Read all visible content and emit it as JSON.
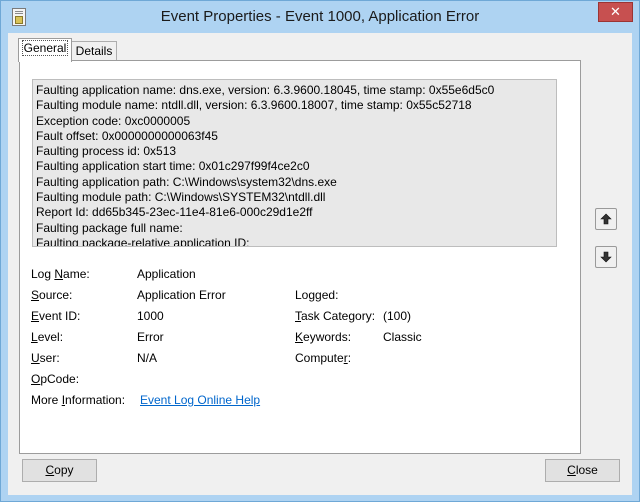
{
  "window": {
    "title": "Event Properties - Event 1000, Application Error",
    "close_glyph": "✕"
  },
  "tabs": [
    {
      "label": "General",
      "active": true
    },
    {
      "label": "Details",
      "active": false
    }
  ],
  "description": [
    "Faulting application name: dns.exe, version: 6.3.9600.18045, time stamp: 0x55e6d5c0",
    "Faulting module name: ntdll.dll, version: 6.3.9600.18007, time stamp: 0x55c52718",
    "Exception code: 0xc0000005",
    "Fault offset: 0x0000000000063f45",
    "Faulting process id: 0x513",
    "Faulting application start time: 0x01c297f99f4ce2c0",
    "Faulting application path: C:\\Windows\\system32\\dns.exe",
    "Faulting module path: C:\\Windows\\SYSTEM32\\ntdll.dll",
    "Report Id: dd65b345-23ec-11e4-81e6-000c29d1e2ff",
    "Faulting package full name:",
    "Faulting package-relative application ID:"
  ],
  "fields": {
    "log_name": {
      "label_pre": "Log ",
      "label_key": "N",
      "label_post": "ame:",
      "value": "Application"
    },
    "source": {
      "label_pre": "",
      "label_key": "S",
      "label_post": "ource:",
      "value": "Application Error"
    },
    "logged": {
      "label_pre": "Lo",
      "label_key": "g",
      "label_post": "ged:",
      "value": ""
    },
    "event_id": {
      "label_pre": "",
      "label_key": "E",
      "label_post": "vent ID:",
      "value": "1000"
    },
    "task_category": {
      "label_pre": "",
      "label_key": "T",
      "label_post": "ask Category:",
      "value": "(100)"
    },
    "level": {
      "label_pre": "",
      "label_key": "L",
      "label_post": "evel:",
      "value": "Error"
    },
    "keywords": {
      "label_pre": "",
      "label_key": "K",
      "label_post": "eywords:",
      "value": "Classic"
    },
    "user": {
      "label_pre": "",
      "label_key": "U",
      "label_post": "ser:",
      "value": "N/A"
    },
    "computer": {
      "label_pre": "Compute",
      "label_key": "r",
      "label_post": ":",
      "value": ""
    },
    "opcode": {
      "label_pre": "",
      "label_key": "O",
      "label_post": "pCode:",
      "value": ""
    },
    "more_info": {
      "label_pre": "More ",
      "label_key": "I",
      "label_post": "nformation:",
      "value": "Event Log Online Help"
    }
  },
  "buttons": {
    "copy_key": "C",
    "copy_rest": "opy",
    "close_key": "C",
    "close_rest": "lose"
  }
}
